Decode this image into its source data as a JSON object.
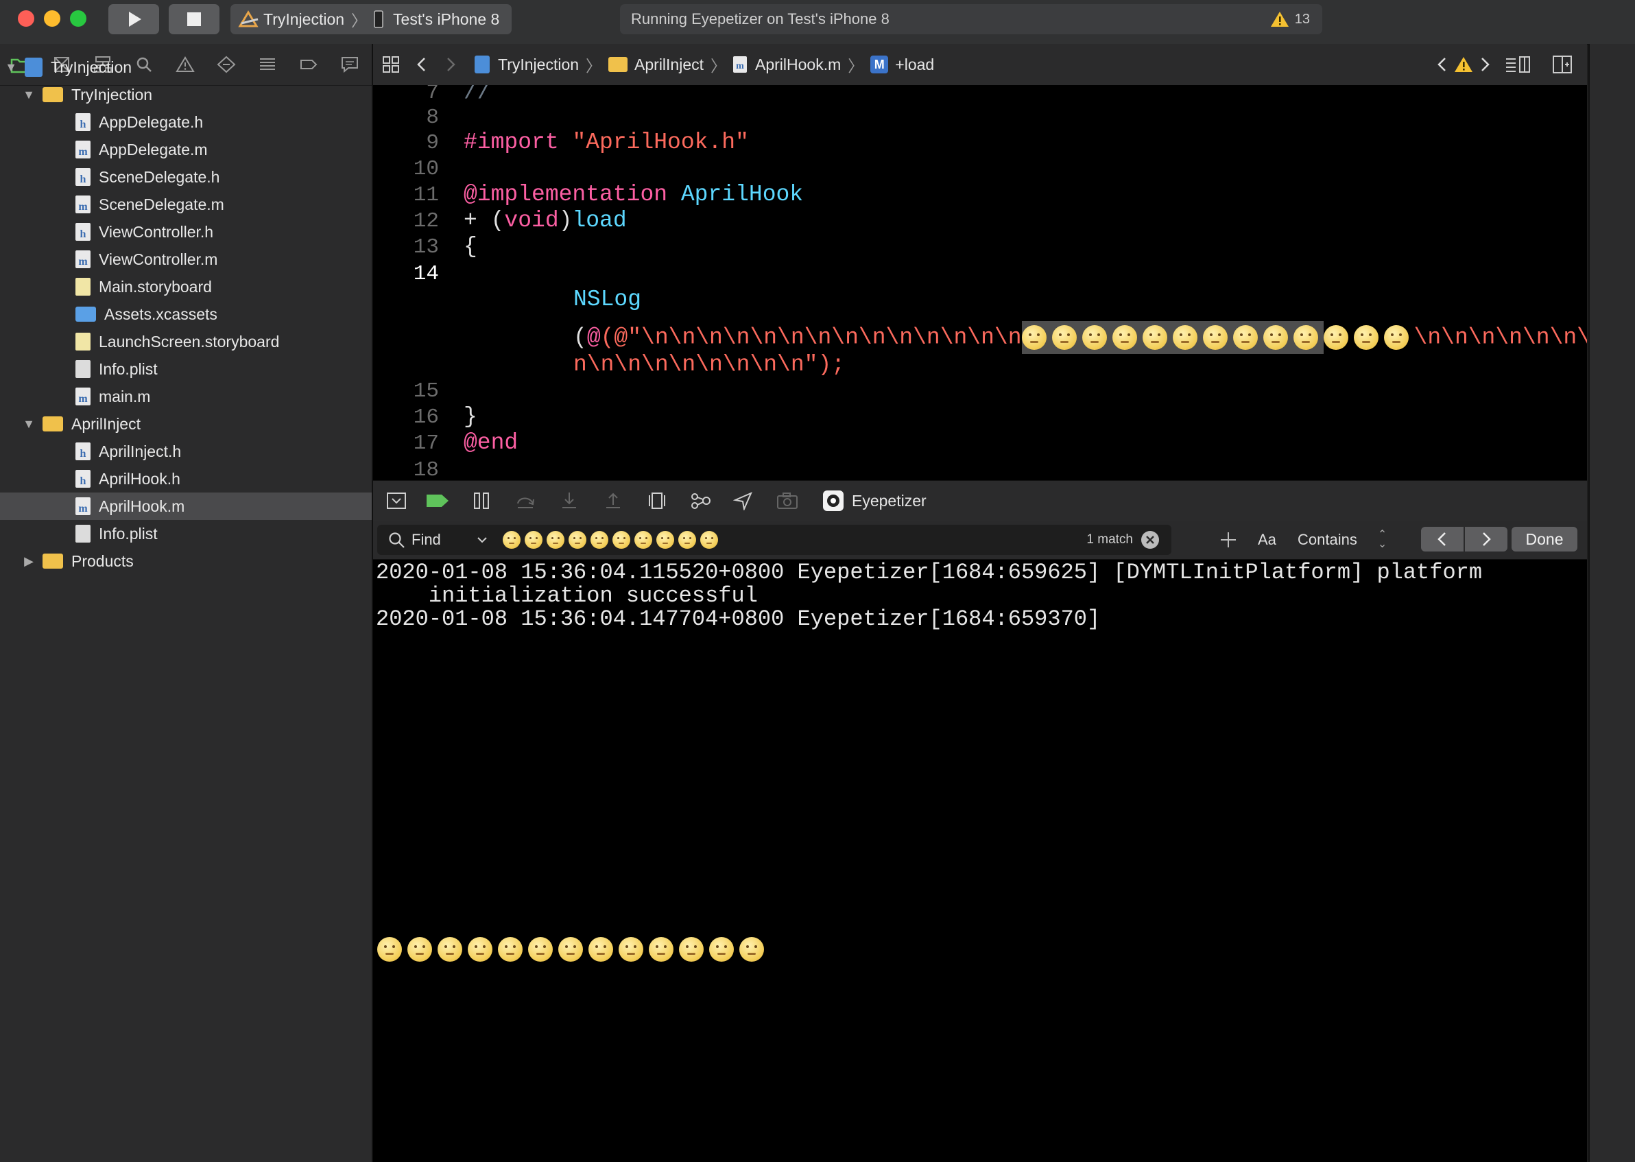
{
  "titlebar": {
    "scheme_name": "TryInjection",
    "device_name": "Test's iPhone 8",
    "status_text": "Running Eyepetizer on Test's iPhone 8",
    "warning_count": "13"
  },
  "navigator": {
    "items": [
      {
        "label": "TryInjection",
        "kind": "project",
        "level": 0,
        "expanded": true
      },
      {
        "label": "TryInjection",
        "kind": "folder",
        "level": 1,
        "expanded": true
      },
      {
        "label": "AppDelegate.h",
        "kind": "h",
        "level": 2
      },
      {
        "label": "AppDelegate.m",
        "kind": "m",
        "level": 2
      },
      {
        "label": "SceneDelegate.h",
        "kind": "h",
        "level": 2
      },
      {
        "label": "SceneDelegate.m",
        "kind": "m",
        "level": 2
      },
      {
        "label": "ViewController.h",
        "kind": "h",
        "level": 2
      },
      {
        "label": "ViewController.m",
        "kind": "m",
        "level": 2
      },
      {
        "label": "Main.storyboard",
        "kind": "storyboard",
        "level": 2
      },
      {
        "label": "Assets.xcassets",
        "kind": "assets",
        "level": 2
      },
      {
        "label": "LaunchScreen.storyboard",
        "kind": "storyboard",
        "level": 2
      },
      {
        "label": "Info.plist",
        "kind": "plist",
        "level": 2
      },
      {
        "label": "main.m",
        "kind": "m",
        "level": 2
      },
      {
        "label": "AprilInject",
        "kind": "folder",
        "level": 1,
        "expanded": true
      },
      {
        "label": "AprilInject.h",
        "kind": "h",
        "level": 2
      },
      {
        "label": "AprilHook.h",
        "kind": "h",
        "level": 2
      },
      {
        "label": "AprilHook.m",
        "kind": "m",
        "level": 2,
        "selected": true
      },
      {
        "label": "Info.plist",
        "kind": "plist",
        "level": 2
      },
      {
        "label": "Products",
        "kind": "folder",
        "level": 1,
        "expanded": false
      }
    ]
  },
  "jumpbar": {
    "crumbs": [
      "TryInjection",
      "AprilInject",
      "AprilHook.m",
      "+load"
    ],
    "method_badge": "M"
  },
  "editor": {
    "lines": [
      {
        "num": "7",
        "text": "//"
      },
      {
        "num": "8",
        "text": ""
      },
      {
        "num": "9",
        "text": "#import \"AprilHook.h\""
      },
      {
        "num": "10",
        "text": ""
      },
      {
        "num": "11",
        "text": "@implementation AprilHook"
      },
      {
        "num": "12",
        "text": "+ (void)load"
      },
      {
        "num": "13",
        "text": "{"
      },
      {
        "num": "14",
        "text": "NSLog"
      },
      {
        "num": "15",
        "text": ""
      },
      {
        "num": "16",
        "text": "}"
      },
      {
        "num": "17",
        "text": "@end"
      },
      {
        "num": "18",
        "text": ""
      }
    ],
    "nslog_prefix": "(@\"\\n\\n\\n\\n\\n\\n\\n\\n\\n\\n\\n\\n\\n\\n",
    "nslog_suffix": "\\n\\n\\n\\n\\n\\n\\",
    "nslog_line2": "n\\n\\n\\n\\n\\n\\n\\n\\n\");",
    "emoji_count_highlighted": 10,
    "emoji_count_plain": 3
  },
  "debugbar": {
    "process_name": "Eyepetizer"
  },
  "findbar": {
    "mode": "Find",
    "query_emoji_count": 10,
    "match_count": "1 match",
    "case_label": "Aa",
    "match_mode": "Contains",
    "done_label": "Done"
  },
  "console": {
    "lines": [
      "2020-01-08 15:36:04.115520+0800 Eyepetizer[1684:659625] [DYMTLInitPlatform] platform",
      "    initialization successful",
      "2020-01-08 15:36:04.147704+0800 Eyepetizer[1684:659370]"
    ],
    "emoji_output_count": 13
  }
}
